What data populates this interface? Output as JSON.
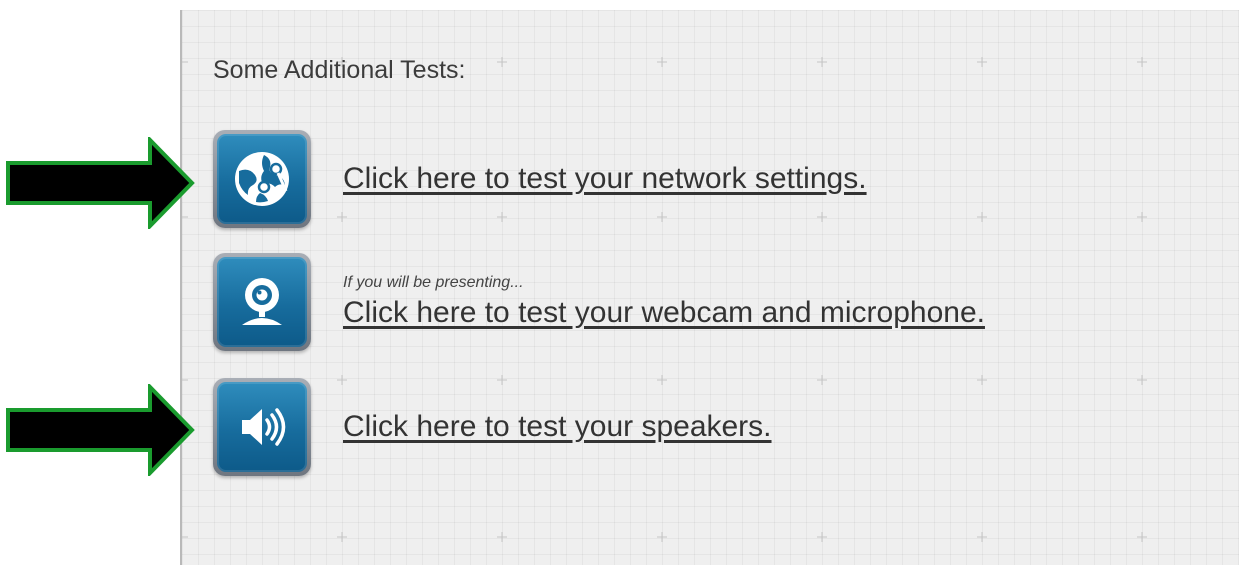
{
  "heading": "Some Additional Tests:",
  "tests": [
    {
      "icon": "network-globe-icon",
      "link": "Click here to test your network settings.",
      "highlighted": true
    },
    {
      "icon": "webcam-icon",
      "note": "If you will be presenting...",
      "link": "Click here to test your webcam and microphone.",
      "highlighted": false
    },
    {
      "icon": "speaker-icon",
      "link": "Click here to test your speakers.",
      "highlighted": true
    }
  ],
  "colors": {
    "icon_blue": "#176c9d",
    "arrow_fill": "#000000",
    "arrow_outline": "#1a9b2e",
    "panel_bg": "#efefef",
    "link_text": "#333333"
  }
}
